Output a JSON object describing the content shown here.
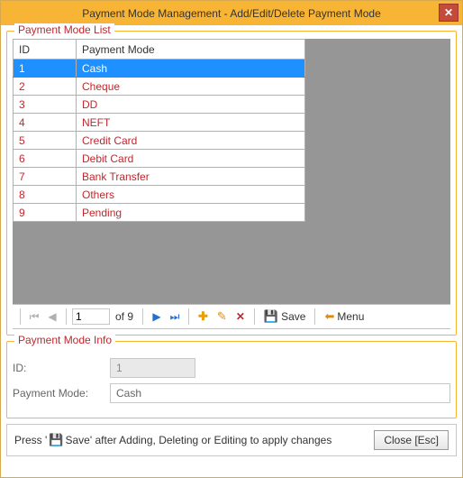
{
  "window": {
    "title": "Payment Mode Management - Add/Edit/Delete Payment Mode"
  },
  "list": {
    "legend": "Payment Mode List",
    "col_id": "ID",
    "col_mode": "Payment Mode",
    "rows": [
      {
        "id": "1",
        "mode": "Cash"
      },
      {
        "id": "2",
        "mode": "Cheque"
      },
      {
        "id": "3",
        "mode": "DD"
      },
      {
        "id": "4",
        "mode": "NEFT"
      },
      {
        "id": "5",
        "mode": "Credit Card"
      },
      {
        "id": "6",
        "mode": "Debit Card"
      },
      {
        "id": "7",
        "mode": "Bank Transfer"
      },
      {
        "id": "8",
        "mode": "Others"
      },
      {
        "id": "9",
        "mode": "Pending"
      }
    ],
    "selected_index": 0
  },
  "nav": {
    "page": "1",
    "of_text": "of 9",
    "save_label": "Save",
    "menu_label": "Menu"
  },
  "info": {
    "legend": "Payment Mode Info",
    "id_label": "ID:",
    "id_value": "1",
    "mode_label": "Payment Mode:",
    "mode_value": "Cash"
  },
  "footer": {
    "hint_before": "Press '",
    "hint_after": "Save' after Adding, Deleting or Editing to apply changes",
    "save_icon_color": "#2468c9",
    "close_label": "Close [Esc]"
  }
}
